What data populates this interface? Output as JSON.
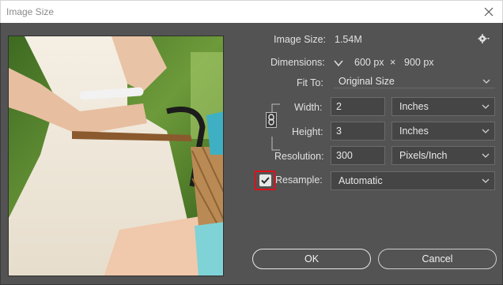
{
  "window": {
    "title": "Image Size"
  },
  "info": {
    "image_size_label": "Image Size:",
    "image_size_value": "1.54M",
    "dimensions_label": "Dimensions:",
    "dim_width": "600 px",
    "dim_sep": "×",
    "dim_height": "900 px"
  },
  "fit_to": {
    "label": "Fit To:",
    "value": "Original Size"
  },
  "width": {
    "label": "Width:",
    "value": "2",
    "unit": "Inches"
  },
  "height": {
    "label": "Height:",
    "value": "3",
    "unit": "Inches"
  },
  "resolution": {
    "label": "Resolution:",
    "value": "300",
    "unit": "Pixels/Inch"
  },
  "resample": {
    "label": "Resample:",
    "checked": true,
    "value": "Automatic"
  },
  "buttons": {
    "ok": "OK",
    "cancel": "Cancel"
  },
  "icons": {
    "gear": "gear-icon",
    "close": "close-icon",
    "chevron": "chevron-down-icon",
    "chain": "chain-link-icon",
    "check": "checkmark-icon"
  },
  "colors": {
    "panel": "#535353",
    "field": "#454545",
    "highlight": "#e0101a"
  }
}
